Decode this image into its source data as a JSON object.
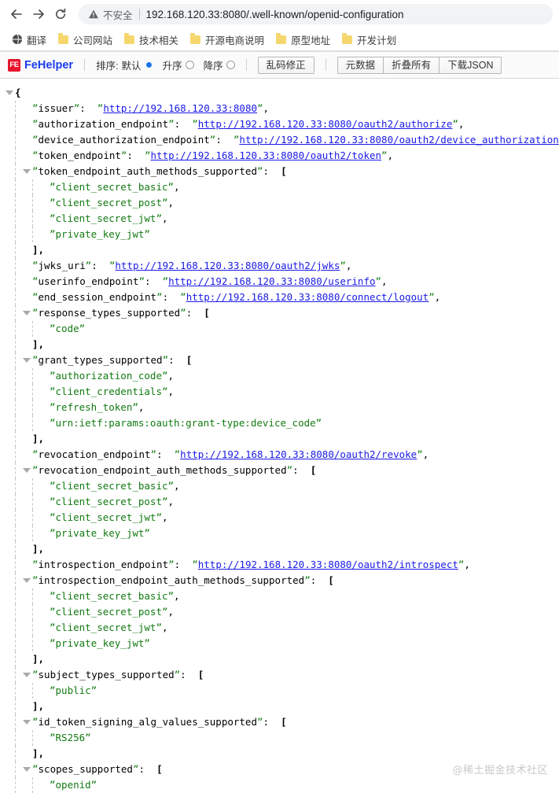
{
  "browser": {
    "back_icon": "arrow-left-icon",
    "forward_icon": "arrow-right-icon",
    "reload_icon": "reload-icon",
    "security_icon": "warning-triangle-icon",
    "security_label": "不安全",
    "url": "192.168.120.33:8080/.well-known/openid-configuration"
  },
  "bookmarks": [
    {
      "label": "翻译",
      "icon": "globe-icon"
    },
    {
      "label": "公司网站",
      "icon": "folder-icon"
    },
    {
      "label": "技术相关",
      "icon": "folder-icon"
    },
    {
      "label": "开源电商说明",
      "icon": "folder-icon"
    },
    {
      "label": "原型地址",
      "icon": "folder-icon"
    },
    {
      "label": "开发计划",
      "icon": "folder-icon"
    }
  ],
  "fehelper": {
    "mark_text": "FE",
    "name": "FeHelper",
    "sort_label": "排序:",
    "sort_options": [
      {
        "label": "默认",
        "selected": true
      },
      {
        "label": "升序",
        "selected": false
      },
      {
        "label": "降序",
        "selected": false
      }
    ],
    "fix_encoding_button": "乱码修正",
    "actions": [
      {
        "label": "元数据"
      },
      {
        "label": "折叠所有"
      },
      {
        "label": "下载JSON"
      }
    ]
  },
  "watermark": "@稀土掘金技术社区",
  "colors": {
    "link": "#1a1ae6",
    "string": "#127a12",
    "accent": "#1a3cf0",
    "logo_red": "#e8142d",
    "radio_blue": "#1a73e8"
  },
  "json_document": {
    "open_brace": "{",
    "lines": [
      {
        "id": "l0",
        "indent": 0,
        "twisty": true,
        "type": "brace",
        "text": "{"
      },
      {
        "id": "l1",
        "indent": 1,
        "twisty": false,
        "type": "link",
        "key": "issuer",
        "value": "http://192.168.120.33:8080",
        "trail": ","
      },
      {
        "id": "l2",
        "indent": 1,
        "twisty": false,
        "type": "link",
        "key": "authorization_endpoint",
        "value": "http://192.168.120.33:8080/oauth2/authorize",
        "trail": ","
      },
      {
        "id": "l3",
        "indent": 1,
        "twisty": false,
        "type": "link",
        "key": "device_authorization_endpoint",
        "value": "http://192.168.120.33:8080/oauth2/device_authorization",
        "trail": ","
      },
      {
        "id": "l4",
        "indent": 1,
        "twisty": false,
        "type": "link",
        "key": "token_endpoint",
        "value": "http://192.168.120.33:8080/oauth2/token",
        "trail": ","
      },
      {
        "id": "l5",
        "indent": 1,
        "twisty": true,
        "type": "arrayopen",
        "key": "token_endpoint_auth_methods_supported"
      },
      {
        "id": "l6",
        "indent": 2,
        "twisty": false,
        "type": "string",
        "value": "client_secret_basic",
        "trail": ","
      },
      {
        "id": "l7",
        "indent": 2,
        "twisty": false,
        "type": "string",
        "value": "client_secret_post",
        "trail": ","
      },
      {
        "id": "l8",
        "indent": 2,
        "twisty": false,
        "type": "string",
        "value": "client_secret_jwt",
        "trail": ","
      },
      {
        "id": "l9",
        "indent": 2,
        "twisty": false,
        "type": "string",
        "value": "private_key_jwt",
        "trail": ""
      },
      {
        "id": "l10",
        "indent": 1,
        "twisty": false,
        "type": "close",
        "text": "],"
      },
      {
        "id": "l11",
        "indent": 1,
        "twisty": false,
        "type": "link",
        "key": "jwks_uri",
        "value": "http://192.168.120.33:8080/oauth2/jwks",
        "trail": ","
      },
      {
        "id": "l12",
        "indent": 1,
        "twisty": false,
        "type": "link",
        "key": "userinfo_endpoint",
        "value": "http://192.168.120.33:8080/userinfo",
        "trail": ","
      },
      {
        "id": "l13",
        "indent": 1,
        "twisty": false,
        "type": "link",
        "key": "end_session_endpoint",
        "value": "http://192.168.120.33:8080/connect/logout",
        "trail": ","
      },
      {
        "id": "l14",
        "indent": 1,
        "twisty": true,
        "type": "arrayopen",
        "key": "response_types_supported"
      },
      {
        "id": "l15",
        "indent": 2,
        "twisty": false,
        "type": "string",
        "value": "code",
        "trail": ""
      },
      {
        "id": "l16",
        "indent": 1,
        "twisty": false,
        "type": "close",
        "text": "],"
      },
      {
        "id": "l17",
        "indent": 1,
        "twisty": true,
        "type": "arrayopen",
        "key": "grant_types_supported"
      },
      {
        "id": "l18",
        "indent": 2,
        "twisty": false,
        "type": "string",
        "value": "authorization_code",
        "trail": ","
      },
      {
        "id": "l19",
        "indent": 2,
        "twisty": false,
        "type": "string",
        "value": "client_credentials",
        "trail": ","
      },
      {
        "id": "l20",
        "indent": 2,
        "twisty": false,
        "type": "string",
        "value": "refresh_token",
        "trail": ","
      },
      {
        "id": "l21",
        "indent": 2,
        "twisty": false,
        "type": "string",
        "value": "urn:ietf:params:oauth:grant-type:device_code",
        "trail": ""
      },
      {
        "id": "l22",
        "indent": 1,
        "twisty": false,
        "type": "close",
        "text": "],"
      },
      {
        "id": "l23",
        "indent": 1,
        "twisty": false,
        "type": "link",
        "key": "revocation_endpoint",
        "value": "http://192.168.120.33:8080/oauth2/revoke",
        "trail": ","
      },
      {
        "id": "l24",
        "indent": 1,
        "twisty": true,
        "type": "arrayopen",
        "key": "revocation_endpoint_auth_methods_supported"
      },
      {
        "id": "l25",
        "indent": 2,
        "twisty": false,
        "type": "string",
        "value": "client_secret_basic",
        "trail": ","
      },
      {
        "id": "l26",
        "indent": 2,
        "twisty": false,
        "type": "string",
        "value": "client_secret_post",
        "trail": ","
      },
      {
        "id": "l27",
        "indent": 2,
        "twisty": false,
        "type": "string",
        "value": "client_secret_jwt",
        "trail": ","
      },
      {
        "id": "l28",
        "indent": 2,
        "twisty": false,
        "type": "string",
        "value": "private_key_jwt",
        "trail": ""
      },
      {
        "id": "l29",
        "indent": 1,
        "twisty": false,
        "type": "close",
        "text": "],"
      },
      {
        "id": "l30",
        "indent": 1,
        "twisty": false,
        "type": "link",
        "key": "introspection_endpoint",
        "value": "http://192.168.120.33:8080/oauth2/introspect",
        "trail": ","
      },
      {
        "id": "l31",
        "indent": 1,
        "twisty": true,
        "type": "arrayopen",
        "key": "introspection_endpoint_auth_methods_supported"
      },
      {
        "id": "l32",
        "indent": 2,
        "twisty": false,
        "type": "string",
        "value": "client_secret_basic",
        "trail": ","
      },
      {
        "id": "l33",
        "indent": 2,
        "twisty": false,
        "type": "string",
        "value": "client_secret_post",
        "trail": ","
      },
      {
        "id": "l34",
        "indent": 2,
        "twisty": false,
        "type": "string",
        "value": "client_secret_jwt",
        "trail": ","
      },
      {
        "id": "l35",
        "indent": 2,
        "twisty": false,
        "type": "string",
        "value": "private_key_jwt",
        "trail": ""
      },
      {
        "id": "l36",
        "indent": 1,
        "twisty": false,
        "type": "close",
        "text": "],"
      },
      {
        "id": "l37",
        "indent": 1,
        "twisty": true,
        "type": "arrayopen",
        "key": "subject_types_supported"
      },
      {
        "id": "l38",
        "indent": 2,
        "twisty": false,
        "type": "string",
        "value": "public",
        "trail": ""
      },
      {
        "id": "l39",
        "indent": 1,
        "twisty": false,
        "type": "close",
        "text": "],"
      },
      {
        "id": "l40",
        "indent": 1,
        "twisty": true,
        "type": "arrayopen",
        "key": "id_token_signing_alg_values_supported"
      },
      {
        "id": "l41",
        "indent": 2,
        "twisty": false,
        "type": "string",
        "value": "RS256",
        "trail": ""
      },
      {
        "id": "l42",
        "indent": 1,
        "twisty": false,
        "type": "close",
        "text": "],"
      },
      {
        "id": "l43",
        "indent": 1,
        "twisty": true,
        "type": "arrayopen",
        "key": "scopes_supported"
      },
      {
        "id": "l44",
        "indent": 2,
        "twisty": false,
        "type": "string",
        "value": "openid",
        "trail": ""
      }
    ]
  }
}
